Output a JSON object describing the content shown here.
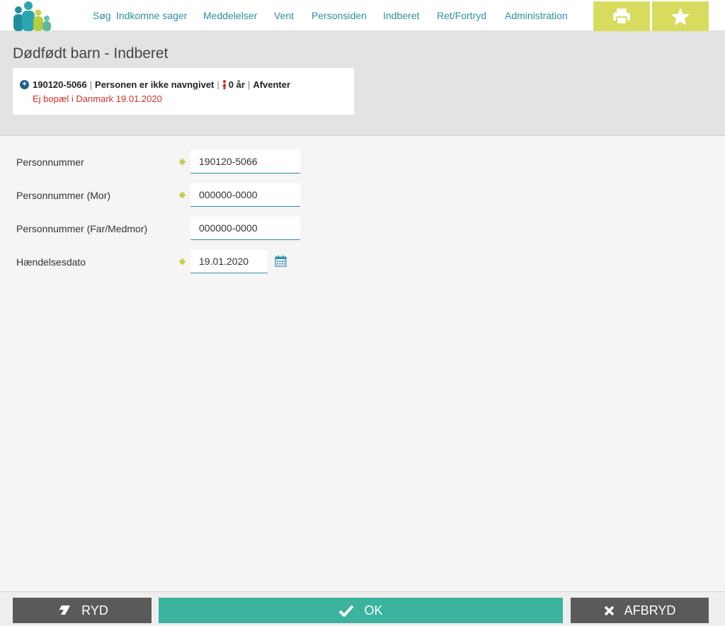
{
  "nav": {
    "items": [
      {
        "label": "Søg"
      },
      {
        "label": "Indkomne sager"
      },
      {
        "label": "Meddelelser"
      },
      {
        "label": "Vent"
      },
      {
        "label": "Personsiden"
      },
      {
        "label": "Indberet"
      },
      {
        "label": "Ret/Fortryd"
      },
      {
        "label": "Administration"
      }
    ],
    "tools": [
      "print-icon",
      "star-icon"
    ]
  },
  "page": {
    "title": "Dødfødt barn - Indberet"
  },
  "person": {
    "cpr": "190120-5066",
    "name": "Personen er ikke navngivet",
    "age": "0 år",
    "status": "Afventer",
    "warning": "Ej bopæl i Danmark 19.01.2020"
  },
  "form": {
    "fields": [
      {
        "label": "Personnummer",
        "value": "190120-5066",
        "required": true
      },
      {
        "label": "Personnummer (Mor)",
        "value": "000000-0000",
        "required": true
      },
      {
        "label": "Personnummer (Far/Medmor)",
        "value": "000000-0000",
        "required": false
      },
      {
        "label": "Hændelsesdato",
        "value": "19.01.2020",
        "required": true
      }
    ]
  },
  "footer": {
    "clear_label": "RYD",
    "ok_label": "OK",
    "cancel_label": "AFBRYD"
  },
  "colors": {
    "accent": "#2f8f9c",
    "tool_yellow": "#d8dc5e",
    "ok_green": "#3bb39e",
    "dark_button": "#5a5a5a",
    "warning_red": "#d0302a"
  }
}
